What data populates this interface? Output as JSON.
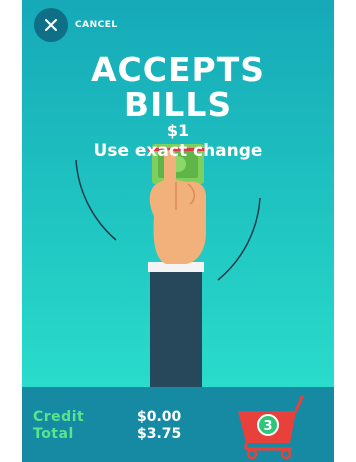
{
  "header": {
    "cancel_label": "CANCEL"
  },
  "headline": {
    "line1": "ACCEPTS",
    "line2": "BILLS",
    "price": "$1",
    "note": "Use exact change"
  },
  "summary": {
    "credit_label": "Credit",
    "credit_value": "$0.00",
    "total_label": "Total",
    "total_value": "$3.75"
  },
  "cart": {
    "item_count": "3",
    "color": "#e8413c"
  },
  "colors": {
    "background_top": "#16a9b8",
    "background_bottom": "#2ee6cf",
    "bottom_bar": "#178aa3",
    "label_green": "#57e68a"
  }
}
